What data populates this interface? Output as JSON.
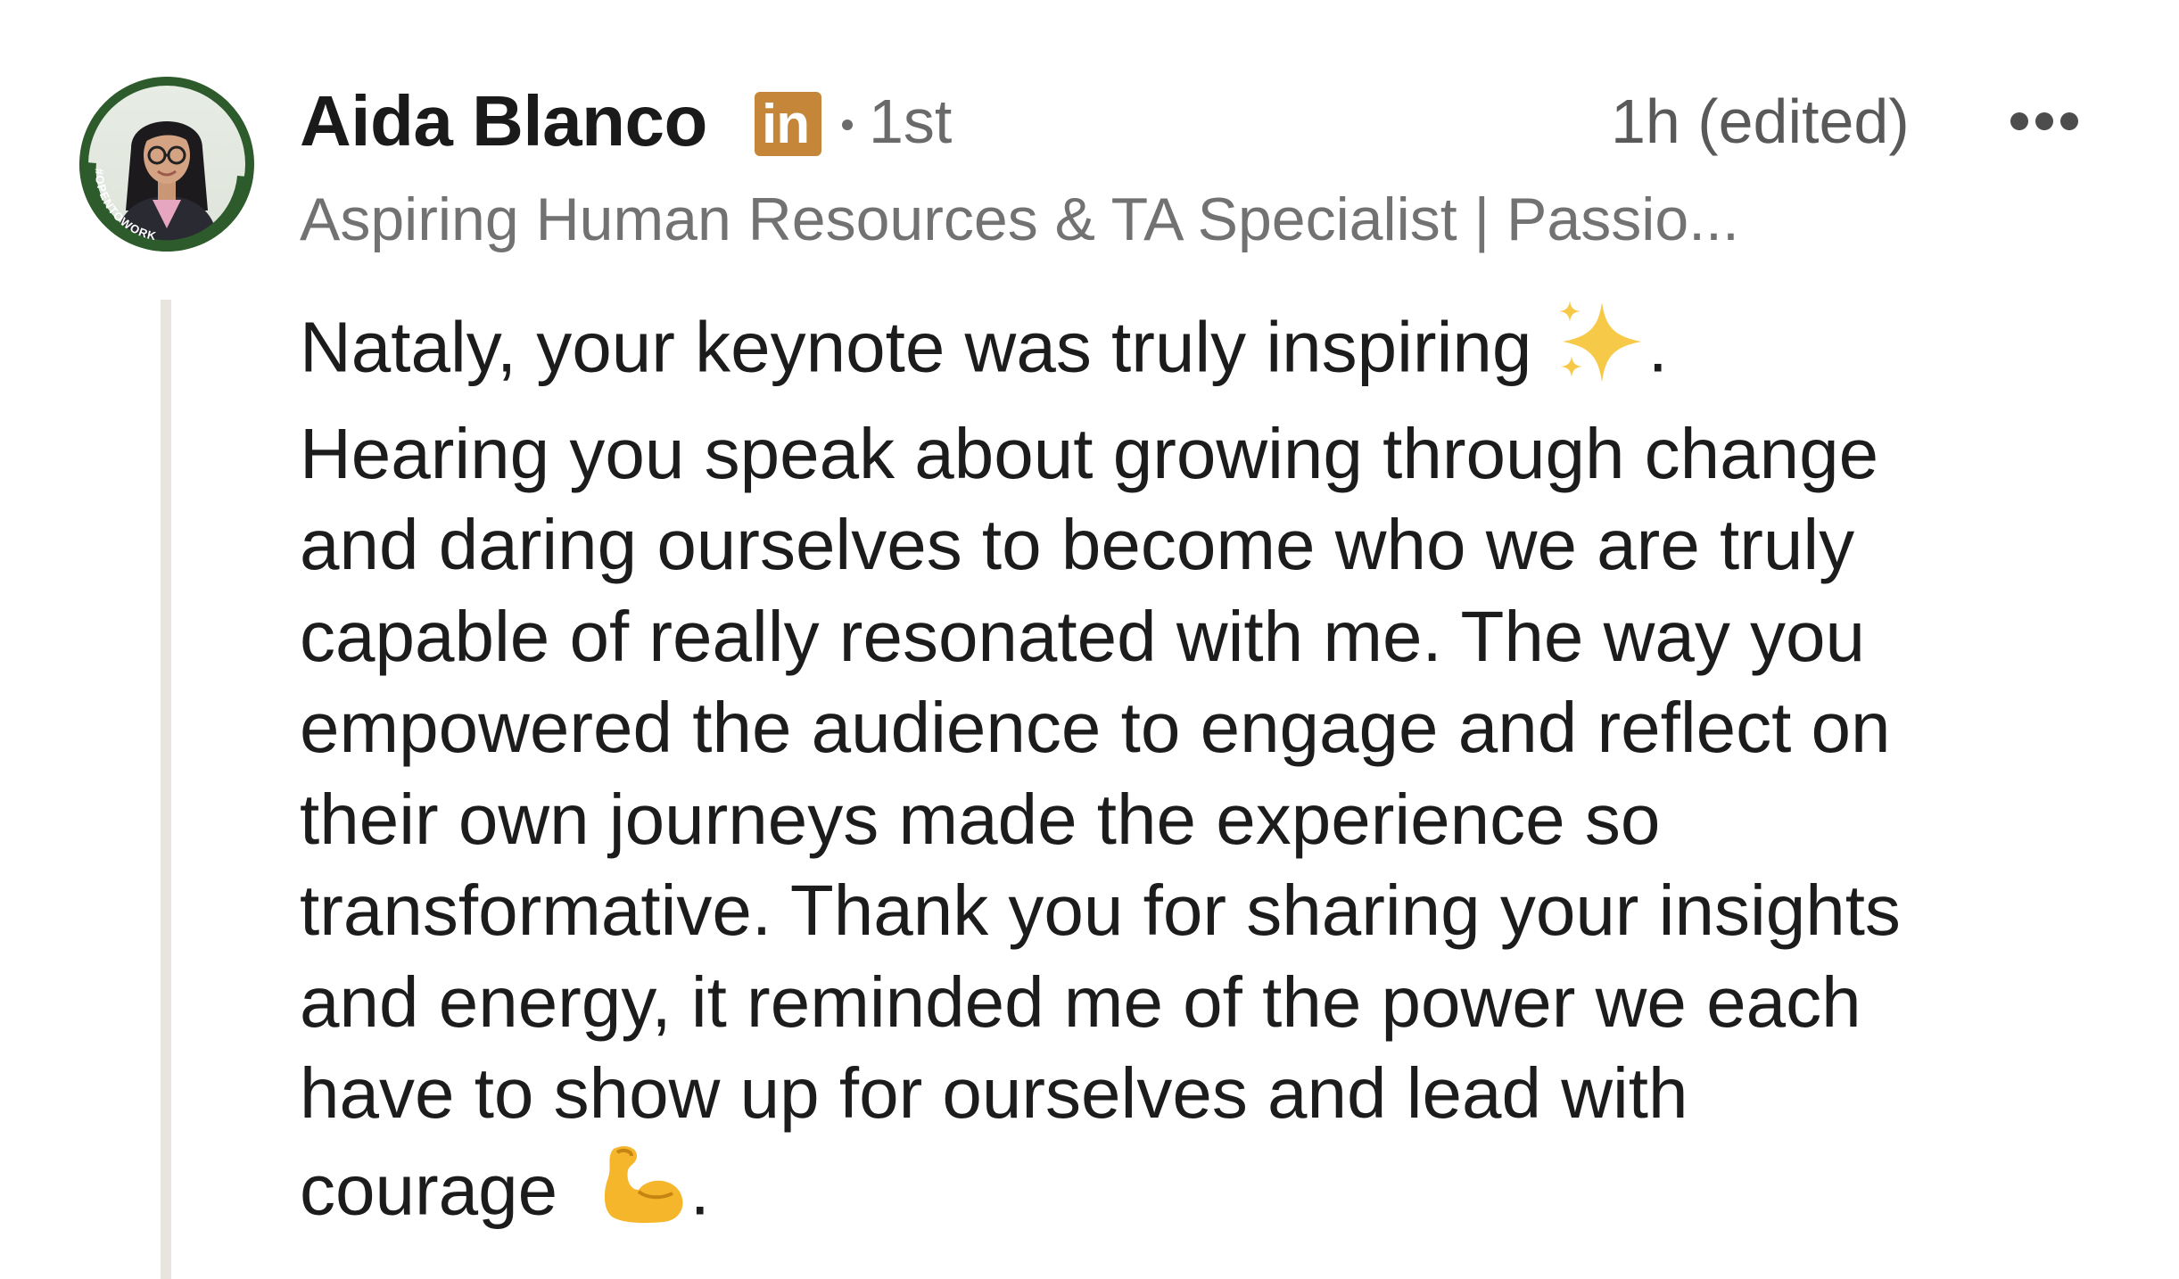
{
  "author": {
    "name": "Aida Blanco",
    "badge_text": "in",
    "connection_degree": "1st",
    "headline": "Aspiring Human Resources & TA Specialist | Passio...",
    "avatar_banner_text": "#OPENTOWORK"
  },
  "meta": {
    "timestamp": "1h (edited)"
  },
  "comment": {
    "lines": [
      "Nataly, your keynote was truly inspiring ",
      "Hearing you speak about growing through change",
      "and daring ourselves to become who we are truly",
      "capable of really resonated with me. The way you",
      "empowered the audience to engage and reflect on",
      "their own journeys made the experience so",
      "transformative. Thank you for sharing your insights",
      "and energy, it reminded me of the power we each",
      "have to show up for ourselves and lead with",
      "courage "
    ],
    "line1_suffix": ".",
    "line10_suffix": ".",
    "emoji": [
      "sparkles",
      "flexed-biceps"
    ]
  },
  "colors": {
    "badge": "#c5863a",
    "opentowork_ring": "#2d5b2b",
    "thread_line": "#e8e5e0"
  }
}
